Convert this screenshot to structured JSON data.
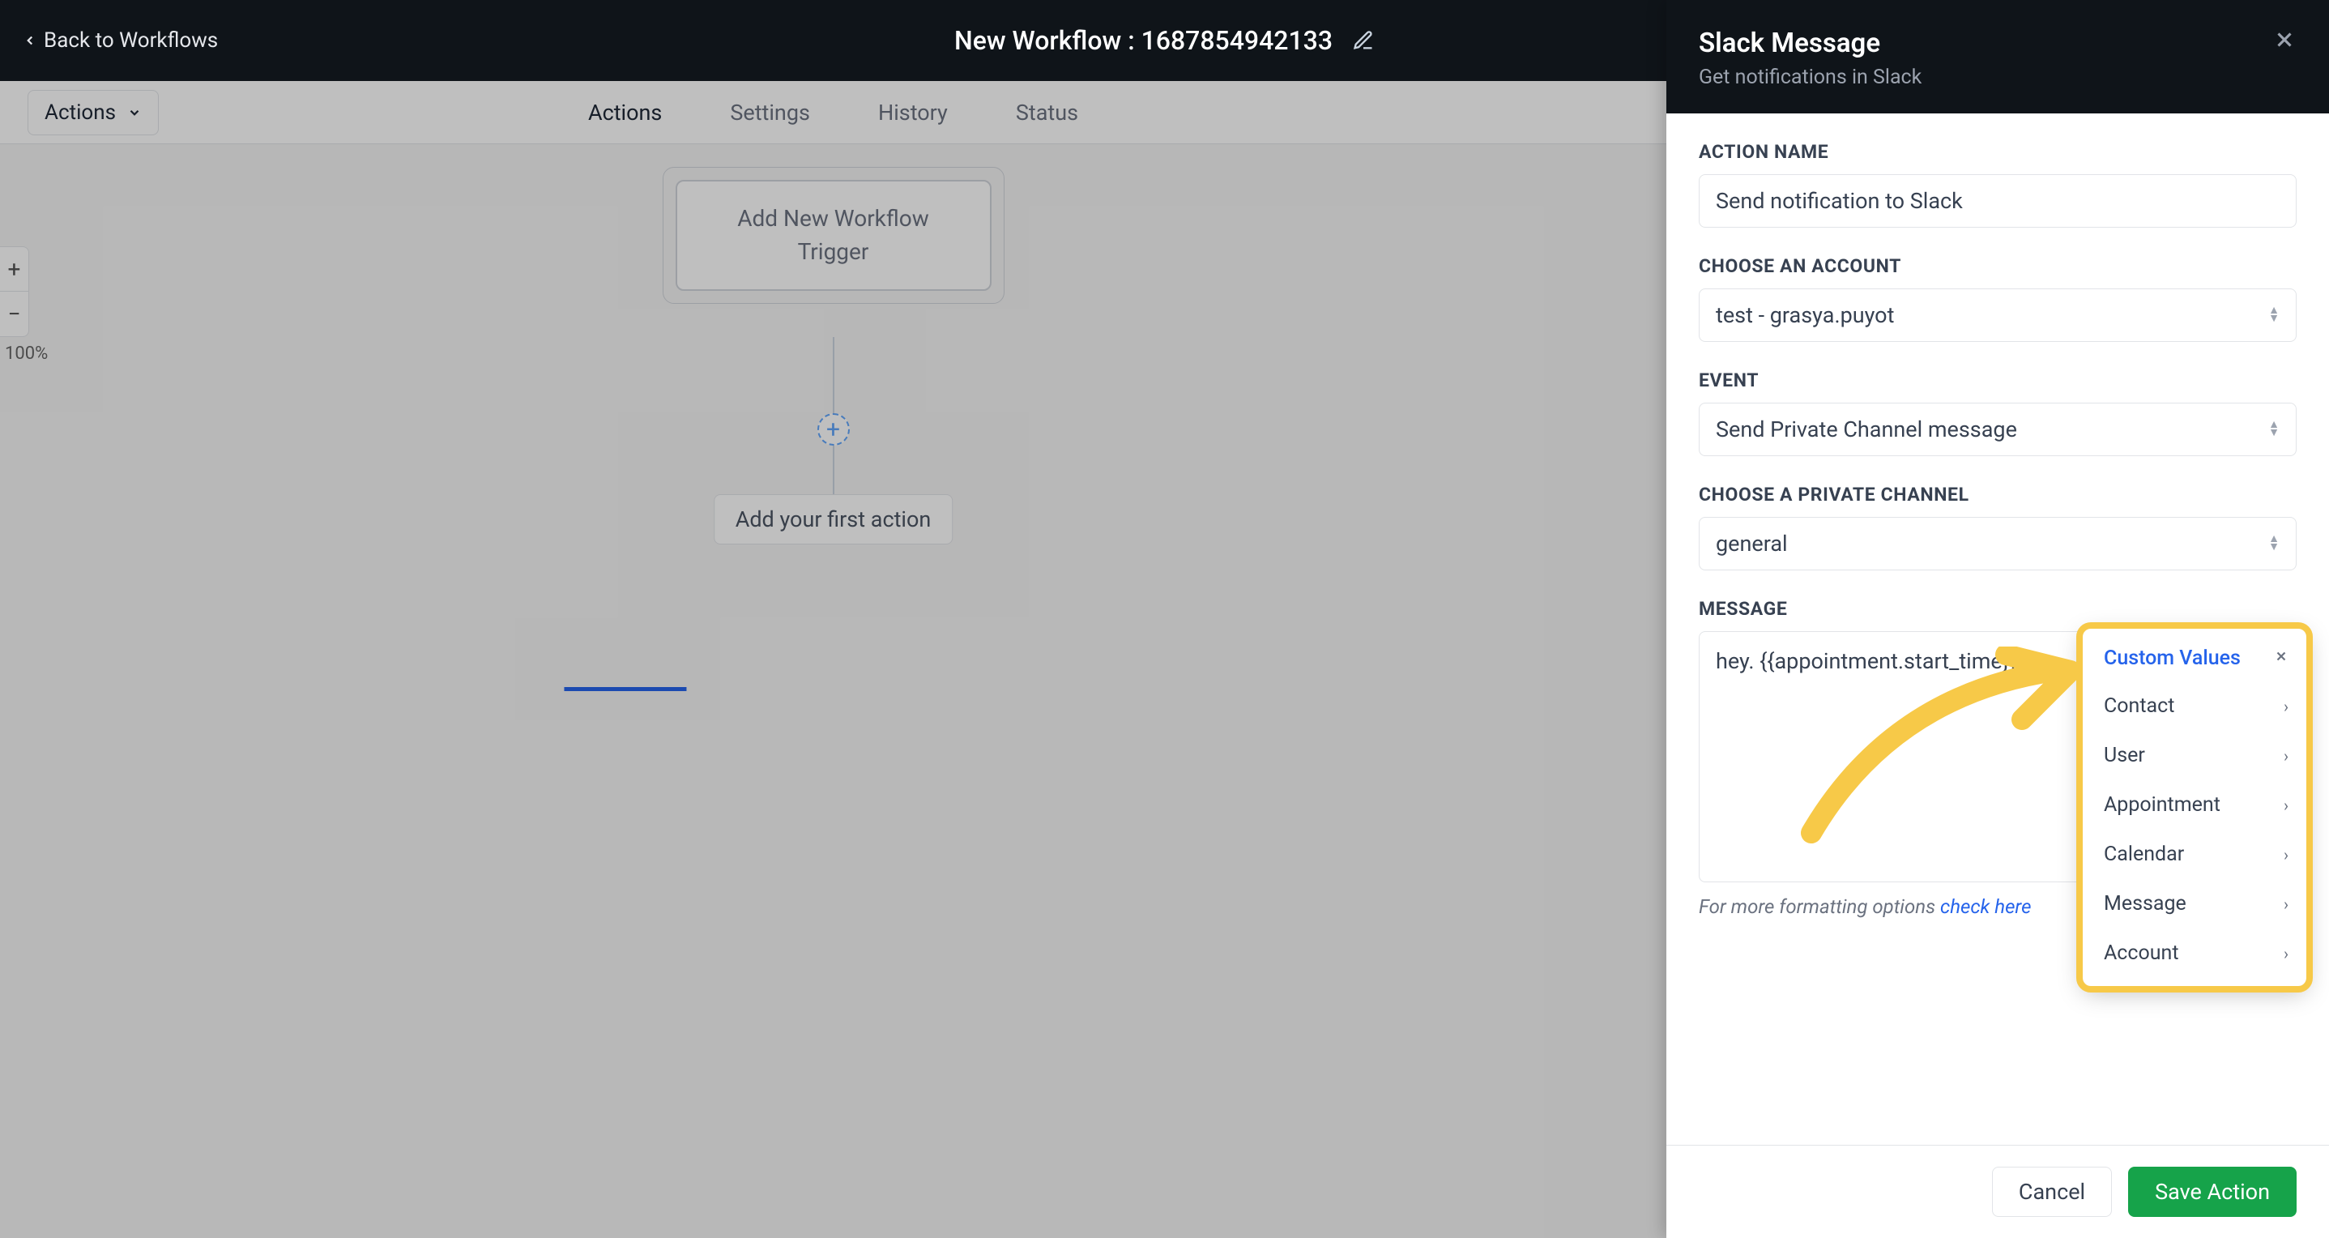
{
  "topbar": {
    "back_label": "Back to Workflows",
    "title": "New Workflow : 1687854942133"
  },
  "canvas": {
    "actions_dd_label": "Actions",
    "zoom_percent": "100%",
    "tabs": [
      "Actions",
      "Settings",
      "History",
      "Status"
    ],
    "trigger_label": "Add New Workflow Trigger",
    "first_action_label": "Add your first action"
  },
  "panel": {
    "title": "Slack Message",
    "subtitle": "Get notifications in Slack",
    "fields": {
      "action_name_label": "ACTION NAME",
      "action_name_value": "Send notification to Slack",
      "account_label": "CHOOSE AN ACCOUNT",
      "account_value": "test - grasya.puyot",
      "event_label": "EVENT",
      "event_value": "Send Private Channel message",
      "channel_label": "CHOOSE A PRIVATE CHANNEL",
      "channel_value": "general",
      "message_label": "MESSAGE",
      "message_value": "hey. {{appointment.start_time}}"
    },
    "helper_prefix": "For more formatting options ",
    "helper_link": "check here",
    "footer": {
      "cancel": "Cancel",
      "save": "Save Action"
    }
  },
  "popover": {
    "title": "Custom Values",
    "items": [
      "Contact",
      "User",
      "Appointment",
      "Calendar",
      "Message",
      "Account"
    ]
  }
}
